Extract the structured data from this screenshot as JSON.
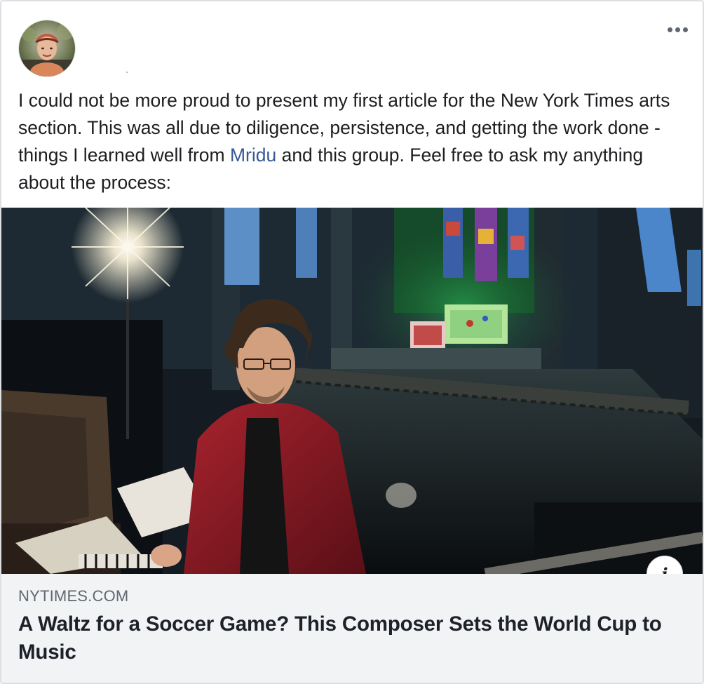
{
  "post": {
    "message_before_link": "I could not be more proud to present my first article for the New York Times arts section. This was all due to diligence, persistence, and getting the work done - things I learned well from ",
    "mention": "Mridu",
    "message_after_link": " and this group. Feel free to ask my anything about the process:",
    "more_icon": "more-horizontal-icon"
  },
  "link_preview": {
    "domain": "NYTIMES.COM",
    "title": "A Waltz for a Soccer Game? This Composer Sets the World Cup to Music",
    "info_label": "i"
  },
  "colors": {
    "mention": "#385898",
    "card_bg": "#f2f3f5",
    "text": "#1c1e21",
    "muted": "#606770"
  }
}
